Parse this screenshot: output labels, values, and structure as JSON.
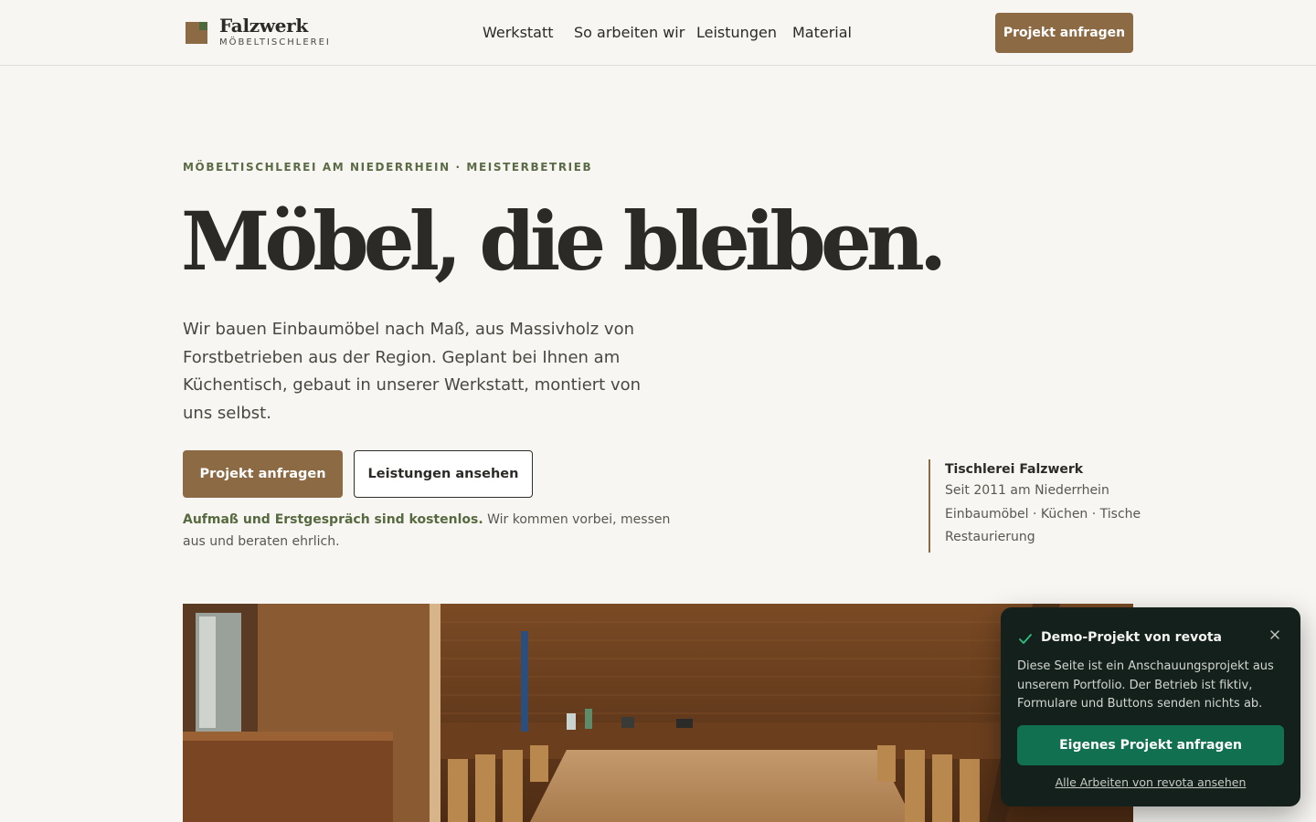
{
  "brand": {
    "name": "Falzwerk",
    "subtitle": "MÖBELTISCHLEREI"
  },
  "nav": {
    "items": [
      "Werkstatt",
      "So arbeiten wir",
      "Leistungen",
      "Material"
    ],
    "cta": "Projekt anfragen"
  },
  "hero": {
    "eyebrow": "MÖBELTISCHLEREI AM NIEDERRHEIN · MEISTERBETRIEB",
    "headline": "Möbel, die bleiben.",
    "lead": "Wir bauen Einbaumöbel nach Maß, aus Massivholz von Forstbetrieben aus der Region. Geplant bei Ihnen am Küchentisch, gebaut in unserer Werkstatt, montiert von uns selbst.",
    "primary_button": "Projekt anfragen",
    "secondary_button": "Leistungen ansehen",
    "note_bold": "Aufmaß und Erstgespräch sind kostenlos.",
    "note_rest": " Wir kommen vorbei, messen aus und beraten ehrlich."
  },
  "side_info": {
    "title": "Tischlerei Falzwerk",
    "lines": [
      "Seit 2011 am Niederrhein",
      "Einbaumöbel · Küchen · Tische",
      "Restaurierung"
    ]
  },
  "toast": {
    "title": "Demo-Projekt von revota",
    "body": "Diese Seite ist ein Anschauungsprojekt aus unserem Portfolio. Der Betrieb ist fiktiv, Formulare und Buttons senden nichts ab.",
    "button": "Eigenes Projekt anfragen",
    "link": "Alle Arbeiten von revota ansehen"
  },
  "colors": {
    "accent_brown": "#8b6a44",
    "accent_green": "#5a6b45",
    "toast_bg": "#14201c",
    "toast_button": "#117050",
    "page_bg": "#f8f6f2"
  }
}
